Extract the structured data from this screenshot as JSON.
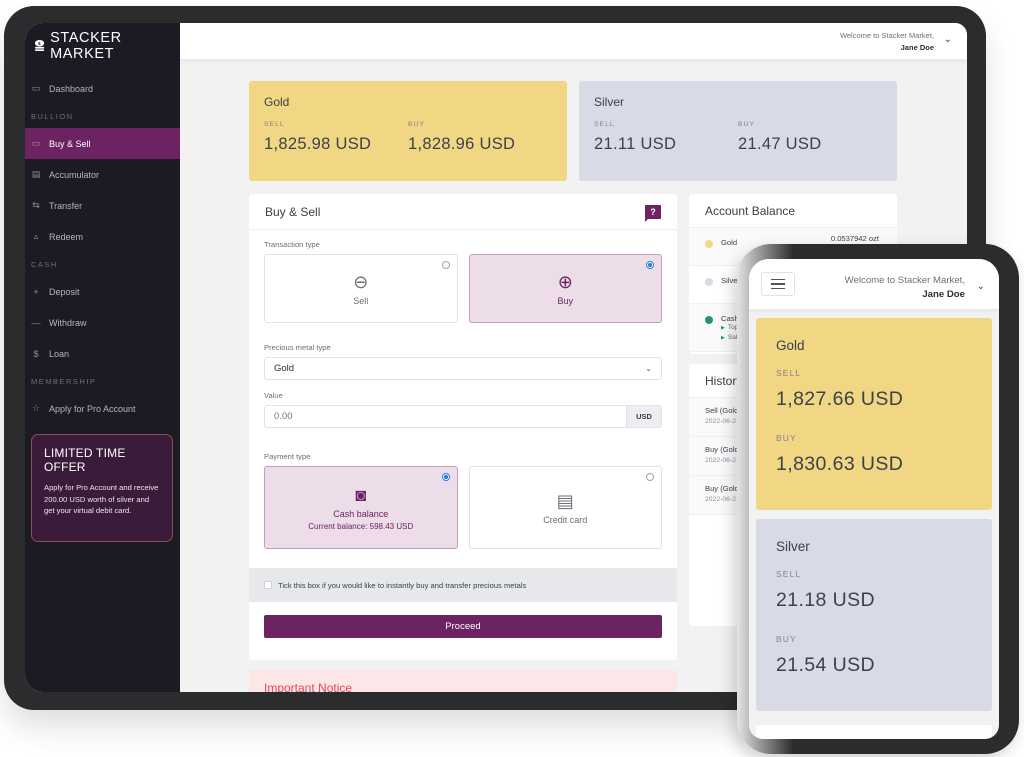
{
  "brand": {
    "name": "STACKER MARKET"
  },
  "sidebar": {
    "items": [
      {
        "label": "Dashboard",
        "icon": "monitor-icon"
      },
      {
        "section": "BULLION"
      },
      {
        "label": "Buy & Sell",
        "icon": "wallet-icon",
        "active": true
      },
      {
        "label": "Accumulator",
        "icon": "calendar-card-icon"
      },
      {
        "label": "Transfer",
        "icon": "arrows-swap-icon"
      },
      {
        "label": "Redeem",
        "icon": "gold-bars-icon"
      },
      {
        "section": "CASH"
      },
      {
        "label": "Deposit",
        "icon": "plus-icon"
      },
      {
        "label": "Withdraw",
        "icon": "minus-icon"
      },
      {
        "label": "Loan",
        "icon": "dollar-icon"
      },
      {
        "section": "MEMBERSHIP"
      },
      {
        "label": "Apply for Pro Account",
        "icon": "star-icon"
      }
    ],
    "promo": {
      "title": "LIMITED TIME OFFER",
      "body": "Apply for Pro Account and receive 200.00 USD worth of silver and get your virtual debit card."
    }
  },
  "header": {
    "welcome": "Welcome to Stacker Market,",
    "user": "Jane Doe"
  },
  "prices": {
    "gold": {
      "title": "Gold",
      "sell_label": "SELL",
      "sell": "1,825.98 USD",
      "buy_label": "BUY",
      "buy": "1,828.96 USD"
    },
    "silver": {
      "title": "Silver",
      "sell_label": "SELL",
      "sell": "21.11 USD",
      "buy_label": "BUY",
      "buy": "21.47 USD"
    }
  },
  "buy_sell": {
    "title": "Buy & Sell",
    "help_label": "?",
    "transaction_type_label": "Transaction type",
    "transaction_options": [
      {
        "label": "Sell",
        "selected": false
      },
      {
        "label": "Buy",
        "selected": true
      }
    ],
    "metal_type_label": "Precious metal type",
    "metal_type_value": "Gold",
    "value_label": "Value",
    "value_placeholder": "0.00",
    "value_currency": "USD",
    "payment_type_label": "Payment type",
    "payment_options": [
      {
        "label": "Cash balance",
        "sub": "Current balance:  598.43 USD",
        "selected": true
      },
      {
        "label": "Credit card",
        "selected": false
      }
    ],
    "tick_label": "Tick this box if you would like to instantly buy and transfer precious metals",
    "proceed_label": "Proceed"
  },
  "notice": {
    "title": "Important Notice"
  },
  "account_balance": {
    "title": "Account Balance",
    "rows": [
      {
        "label": "Gold",
        "amount": "0.0537942 ozt",
        "color": "#f1d784"
      },
      {
        "label": "Silver",
        "color": "#d8dbe5"
      },
      {
        "label": "Cash",
        "color": "#2a8f7a",
        "sub": [
          "Top",
          "Sale"
        ]
      }
    ]
  },
  "history": {
    "title": "History",
    "rows": [
      {
        "action": "Sell (Gold",
        "date": "2022-06-2"
      },
      {
        "action": "Buy (Gold",
        "date": "2022-06-2"
      },
      {
        "action": "Buy (Gold",
        "date": "2022-06-2"
      }
    ]
  },
  "mobile": {
    "welcome": "Welcome to Stacker Market,",
    "user": "Jane Doe",
    "gold": {
      "title": "Gold",
      "sell_label": "SELL",
      "sell": "1,827.66 USD",
      "buy_label": "BUY",
      "buy": "1,830.63 USD"
    },
    "silver": {
      "title": "Silver",
      "sell_label": "SELL",
      "sell": "21.18 USD",
      "buy_label": "BUY",
      "buy": "21.54 USD"
    }
  },
  "colors": {
    "accent": "#6d2262",
    "gold": "#f1d784",
    "silver": "#d8dbe5",
    "sidebar": "#1c1a23",
    "notice": "#e0485a"
  }
}
